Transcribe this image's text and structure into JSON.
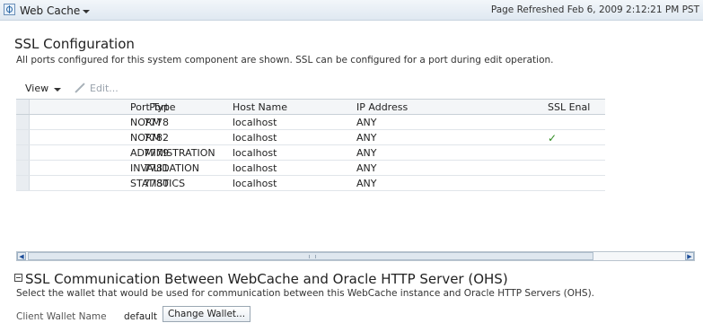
{
  "header": {
    "component_menu": "Web Cache",
    "refreshed": "Page Refreshed Feb 6, 2009 2:12:21 PM PST"
  },
  "ssl_config": {
    "title": "SSL Configuration",
    "description": "All ports configured for this system component are shown. SSL can be configured for a port during edit operation.",
    "toolbar": {
      "view": "View",
      "edit": "Edit..."
    },
    "columns": [
      "Port",
      "Port Type",
      "Host Name",
      "IP Address",
      "SSL Enal"
    ],
    "rows": [
      {
        "port": "7778",
        "type": "NORM",
        "host": "localhost",
        "ip": "ANY",
        "ssl": ""
      },
      {
        "port": "7782",
        "type": "NORM",
        "host": "localhost",
        "ip": "ANY",
        "ssl": "✓"
      },
      {
        "port": "7779",
        "type": "ADMINISTRATION",
        "host": "localhost",
        "ip": "ANY",
        "ssl": ""
      },
      {
        "port": "7781",
        "type": "INVALIDATION",
        "host": "localhost",
        "ip": "ANY",
        "ssl": ""
      },
      {
        "port": "7780",
        "type": "STATISTICS",
        "host": "localhost",
        "ip": "ANY",
        "ssl": ""
      }
    ]
  },
  "ohs_section": {
    "title": "SSL Communication Between WebCache and Oracle HTTP Server (OHS)",
    "description": "Select the wallet that would be used for communication between this WebCache instance and Oracle HTTP Servers (OHS).",
    "wallet_label": "Client Wallet Name",
    "wallet_value": "default",
    "change_button": "Change Wallet..."
  },
  "icons": {
    "component": "web-cache-icon",
    "dropdown": "chevron-down-icon",
    "edit": "pencil-icon",
    "collapse": "collapse-icon",
    "check": "checkmark-icon",
    "scroll_left": "scroll-left-icon",
    "scroll_right": "scroll-right-icon"
  }
}
